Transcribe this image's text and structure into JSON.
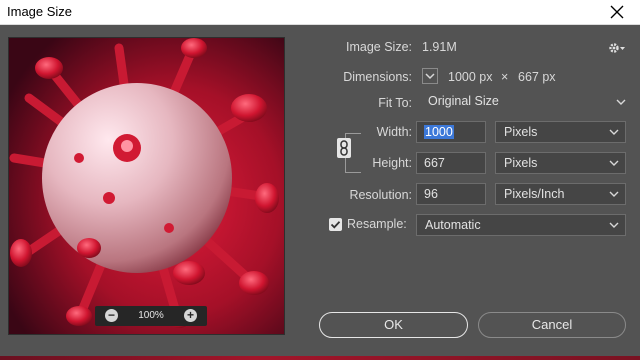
{
  "window": {
    "title": "Image Size"
  },
  "preview": {
    "zoom": "100%"
  },
  "image_size": {
    "label": "Image Size:",
    "value": "1.91M"
  },
  "dimensions": {
    "label": "Dimensions:",
    "width": "1000 px",
    "times": "×",
    "height": "667 px"
  },
  "fit_to": {
    "label": "Fit To:",
    "value": "Original Size"
  },
  "width": {
    "label": "Width:",
    "value": "1000",
    "unit": "Pixels"
  },
  "height": {
    "label": "Height:",
    "value": "667",
    "unit": "Pixels"
  },
  "resolution": {
    "label": "Resolution:",
    "value": "96",
    "unit": "Pixels/Inch"
  },
  "resample": {
    "label": "Resample:",
    "checked": true,
    "value": "Automatic"
  },
  "buttons": {
    "ok": "OK",
    "cancel": "Cancel"
  },
  "colors": {
    "dialog_bg": "#535353",
    "field_bg": "#454545",
    "accent_selection": "#3c78d8",
    "image_red": "#c2142b"
  }
}
